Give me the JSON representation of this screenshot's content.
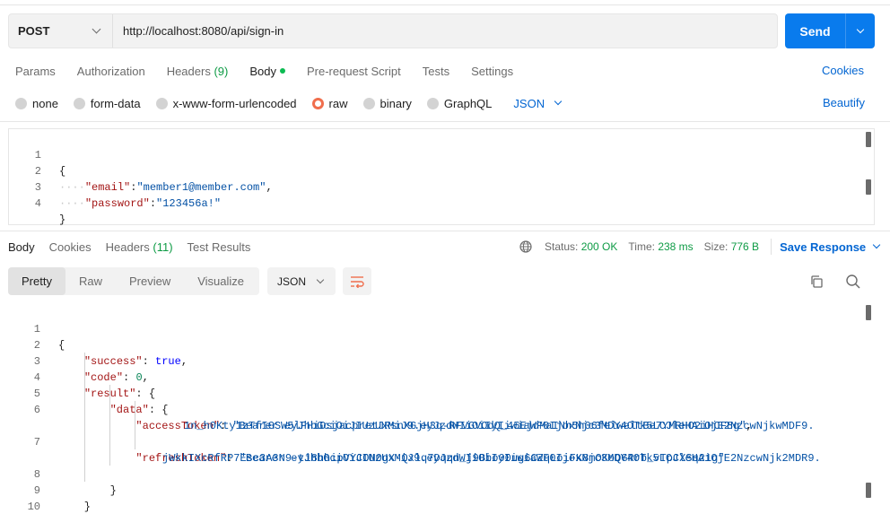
{
  "request": {
    "method": "POST",
    "url": "http://localhost:8080/api/sign-in",
    "send_label": "Send"
  },
  "req_tabs": {
    "params": "Params",
    "authorization": "Authorization",
    "headers": "Headers",
    "headers_count": "(9)",
    "body": "Body",
    "pre_request": "Pre-request Script",
    "tests": "Tests",
    "settings": "Settings",
    "cookies": "Cookies"
  },
  "body_types": {
    "none": "none",
    "form_data": "form-data",
    "urlencoded": "x-www-form-urlencoded",
    "raw": "raw",
    "binary": "binary",
    "graphql": "GraphQL",
    "format": "JSON",
    "beautify": "Beautify"
  },
  "request_body": {
    "line_numbers": [
      "1",
      "2",
      "3",
      "4"
    ],
    "open_brace": "{",
    "close_brace": "}",
    "email_key": "\"email\"",
    "email_value": "\"member1@member.com\"",
    "password_key": "\"password\"",
    "password_value": "\"123456a!\""
  },
  "response_tabs": {
    "body": "Body",
    "cookies": "Cookies",
    "headers": "Headers",
    "headers_count": "(11)",
    "test_results": "Test Results"
  },
  "response_meta": {
    "status_label": "Status:",
    "status_value": "200 OK",
    "time_label": "Time:",
    "time_value": "238 ms",
    "size_label": "Size:",
    "size_value": "776 B",
    "save_response": "Save Response"
  },
  "response_view": {
    "pretty": "Pretty",
    "raw": "Raw",
    "preview": "Preview",
    "visualize": "Visualize",
    "format": "JSON"
  },
  "response_body": {
    "line_numbers": [
      "1",
      "2",
      "3",
      "4",
      "5",
      "6",
      "7",
      "8",
      "9",
      "10"
    ],
    "open_brace": "{",
    "close_brace": "}",
    "success_key": "\"success\"",
    "success_value": "true",
    "code_key": "\"code\"",
    "code_value": "0",
    "result_key": "\"result\"",
    "data_key": "\"data\"",
    "access_key": "\"accessToken\"",
    "access_value_1": "\"Bearer eyJhbGciOiJIUzUxMiJ9.eyJzdWIiOiIyIiwiaWF0IjoxNjc3MDY4OTk5LCJleHAiOjE2NzcwNjkwMDF9.",
    "access_value_2": "1n_h0Kty1zTfIGSW5lFHiDsjacpretJRsnXGjH3q-RFVGVOdQ_45EjdMaINh5h06felweltBe7YMRHO2iHCF8g\"",
    "refresh_key": "\"refreshToken\"",
    "refresh_value_1": "\"Bearer eyJhbGciOiJIUzUxMiJ9.eyJzdWIiOiIyIiwiaWF0IjoxNjc3MDY4OTk5LCJleHAiOjE2NzcwNjk2MDR9.",
    "refresh_value_2": "jWkkIXcRfRP7Esc3A3N9-ti8hhipVYCON0gX-Qxlq7Dqqn_j9Bbo00ug6CZqLoiFK8mOKoQGRrb_vTpCXSq21g\""
  }
}
